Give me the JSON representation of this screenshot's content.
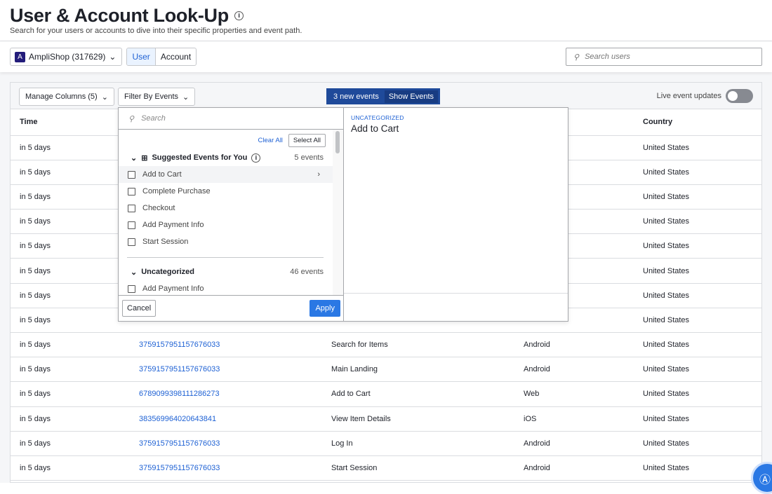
{
  "header": {
    "title": "User & Account Look-Up",
    "subtitle": "Search for your users or accounts to dive into their specific properties and event path."
  },
  "controls": {
    "project_initial": "A",
    "project": "AmpliShop (317629)",
    "toggle": [
      "User",
      "Account"
    ],
    "active": "User",
    "search_placeholder": "Search users"
  },
  "toolbar": {
    "manage_columns": "Manage Columns (5)",
    "filter_events": "Filter By Events",
    "new_events": "3 new events",
    "show_events": "Show Events",
    "live_updates": "Live event updates",
    "live_on": false
  },
  "table": {
    "headers": [
      "Time",
      "",
      "",
      "",
      "Country"
    ],
    "rows": [
      [
        "in 5 days",
        "",
        "",
        "",
        "United States"
      ],
      [
        "in 5 days",
        "",
        "",
        "",
        "United States"
      ],
      [
        "in 5 days",
        "",
        "",
        "",
        "United States"
      ],
      [
        "in 5 days",
        "",
        "",
        "",
        "United States"
      ],
      [
        "in 5 days",
        "",
        "",
        "",
        "United States"
      ],
      [
        "in 5 days",
        "",
        "",
        "",
        "United States"
      ],
      [
        "in 5 days",
        "",
        "",
        "",
        "United States"
      ],
      [
        "in 5 days",
        "",
        "",
        "",
        "United States"
      ],
      [
        "in 5 days",
        "3759157951157676033",
        "Search for Items",
        "Android",
        "United States"
      ],
      [
        "in 5 days",
        "3759157951157676033",
        "Main Landing",
        "Android",
        "United States"
      ],
      [
        "in 5 days",
        "6789099398111286273",
        "Add to Cart",
        "Web",
        "United States"
      ],
      [
        "in 5 days",
        "383569964020643841",
        "View Item Details",
        "iOS",
        "United States"
      ],
      [
        "in 5 days",
        "3759157951157676033",
        "Log In",
        "Android",
        "United States"
      ],
      [
        "in 5 days",
        "3759157951157676033",
        "Start Session",
        "Android",
        "United States"
      ]
    ]
  },
  "dropdown": {
    "search_placeholder": "Search",
    "clear_all": "Clear All",
    "select_all": "Select All",
    "groups": [
      {
        "label": "Suggested Events for You",
        "count": "5 events",
        "items": [
          "Add to Cart",
          "Complete Purchase",
          "Checkout",
          "Add Payment Info",
          "Start Session"
        ]
      },
      {
        "label": "Uncategorized",
        "count": "46 events",
        "items": [
          "Add Payment Info"
        ]
      }
    ],
    "cancel": "Cancel",
    "apply": "Apply",
    "detail": {
      "category": "UNCATEGORIZED",
      "name": "Add to Cart"
    }
  },
  "colors": {
    "accent": "#1e61d4",
    "primary_button": "#2a78e4",
    "banner": "#1f4a9a"
  }
}
